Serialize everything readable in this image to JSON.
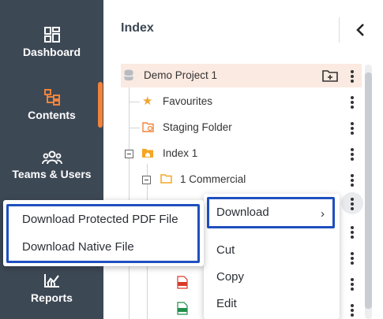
{
  "nav": {
    "items": [
      {
        "label": "Dashboard"
      },
      {
        "label": "Contents"
      },
      {
        "label": "Teams & Users"
      },
      {
        "label": "Reports"
      }
    ]
  },
  "header": {
    "title": "Index"
  },
  "tree": {
    "project": "Demo Project 1",
    "favourites": "Favourites",
    "staging": "Staging Folder",
    "index": "Index 1",
    "commercial": "1 Commercial"
  },
  "context_menu": {
    "download": "Download",
    "cut": "Cut",
    "copy": "Copy",
    "edit": "Edit"
  },
  "download_submenu": {
    "protected_pdf": "Download Protected PDF File",
    "native": "Download Native File"
  },
  "colors": {
    "nav_bg": "#3d4855",
    "accent": "#f0843b",
    "highlight_border": "#1f4fbf",
    "selected_row": "#fbeae1"
  }
}
